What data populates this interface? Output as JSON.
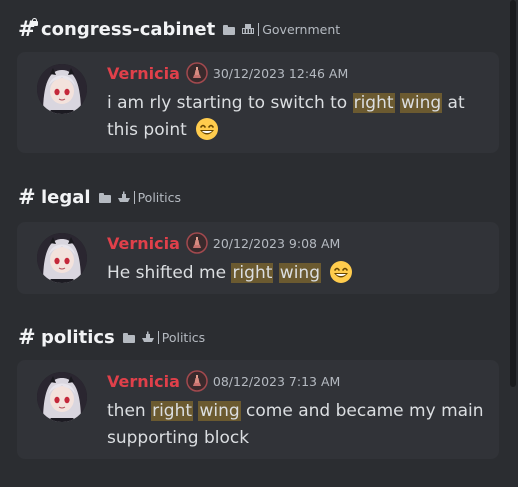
{
  "results": [
    {
      "channel": "congress-cabinet",
      "category": "Government",
      "locked": true,
      "message": {
        "author": "Vernicia",
        "timestamp": "30/12/2023 12:46 AM",
        "parts": [
          {
            "text": "i am rly starting to switch to ",
            "highlight": false
          },
          {
            "text": "right",
            "highlight": true
          },
          {
            "text": " ",
            "highlight": false
          },
          {
            "text": "wing",
            "highlight": true
          },
          {
            "text": " at this point",
            "highlight": false
          }
        ],
        "emoji": "grinning-face-with-smiling-eyes"
      }
    },
    {
      "channel": "legal",
      "category": "Politics",
      "locked": false,
      "message": {
        "author": "Vernicia",
        "timestamp": "20/12/2023 9:08 AM",
        "parts": [
          {
            "text": "He shifted me ",
            "highlight": false
          },
          {
            "text": "right",
            "highlight": true
          },
          {
            "text": " ",
            "highlight": false
          },
          {
            "text": "wing",
            "highlight": true
          }
        ],
        "emoji": "grinning-face-with-smiling-eyes"
      }
    },
    {
      "channel": "politics",
      "category": "Politics",
      "locked": false,
      "message": {
        "author": "Vernicia",
        "timestamp": "08/12/2023 7:13 AM",
        "parts": [
          {
            "text": "then ",
            "highlight": false
          },
          {
            "text": "right",
            "highlight": true
          },
          {
            "text": " ",
            "highlight": false
          },
          {
            "text": "wing",
            "highlight": true
          },
          {
            "text": " come and became my main supporting block",
            "highlight": false
          }
        ],
        "emoji": null
      }
    }
  ],
  "colors": {
    "background": "#2b2d31",
    "card": "#313338",
    "author": "#e0404a",
    "highlight": "#6b5a30"
  },
  "icons": {
    "channel": "hash-icon",
    "private": "lock-icon",
    "folder": "folder-icon",
    "government_category": "building-icon",
    "politics_category": "ship-icon",
    "role_badge": "role-badge-icon"
  }
}
